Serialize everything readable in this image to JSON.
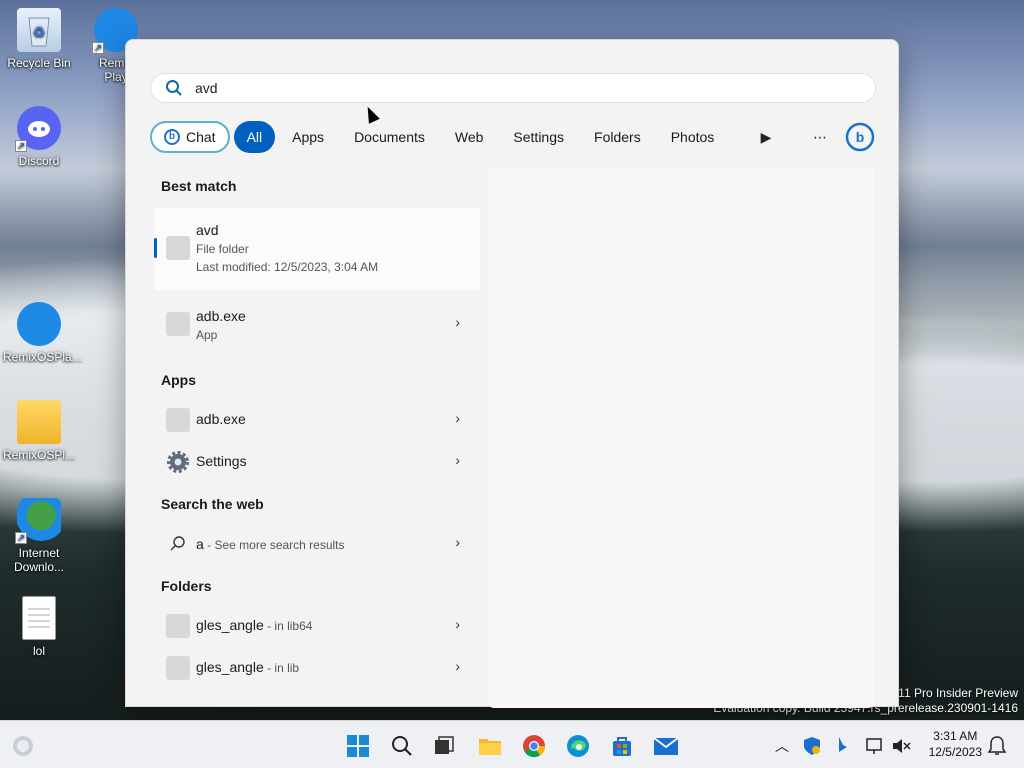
{
  "desktop": {
    "icons": [
      {
        "label": "Recycle Bin",
        "icon": "recycle-bin-icon"
      },
      {
        "label": "Remix\nPlay",
        "icon": "remixos-icon"
      },
      {
        "label": "Discord",
        "icon": "discord-icon"
      },
      {
        "label": "RemixOSPla...",
        "icon": "remixos-icon"
      },
      {
        "label": "RemixOSPl...",
        "icon": "folder-icon"
      },
      {
        "label": "Internet\nDownlo...",
        "icon": "idm-icon"
      },
      {
        "label": "lol",
        "icon": "text-file-icon"
      }
    ]
  },
  "search": {
    "query": "avd",
    "filters": [
      "Chat",
      "All",
      "Apps",
      "Documents",
      "Web",
      "Settings",
      "Folders",
      "Photos"
    ],
    "active_filter": "All",
    "best_match": {
      "heading": "Best match",
      "name": "avd",
      "type": "File folder",
      "modified": "Last modified: 12/5/2023, 3:04 AM"
    },
    "adb_top": {
      "name": "adb.exe",
      "type": "App"
    },
    "apps": {
      "heading": "Apps",
      "items": [
        {
          "name": "adb.exe"
        },
        {
          "name": "Settings"
        }
      ]
    },
    "web": {
      "heading": "Search the web",
      "query": "a",
      "hint": " - See more search results"
    },
    "folders": {
      "heading": "Folders",
      "items": [
        {
          "name": "gles_angle",
          "location": " - in lib64"
        },
        {
          "name": "gles_angle",
          "location": " - in lib"
        }
      ]
    }
  },
  "watermark": {
    "line1": "11 Pro Insider Preview",
    "line2": "Evaluation copy. Build 25947.rs_prerelease.230901-1416"
  },
  "taskbar": {
    "time": "3:31 AM",
    "date": "12/5/2023",
    "colors": {
      "accent": "#0060c0",
      "chat_border": "#5bb3c8"
    }
  }
}
